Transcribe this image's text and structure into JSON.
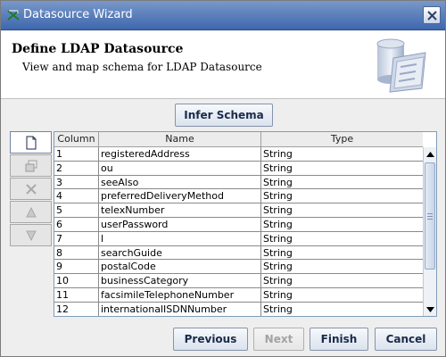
{
  "window": {
    "title": "Datasource Wizard"
  },
  "header": {
    "title": "Define LDAP Datasource",
    "subtitle": "View and map schema for LDAP Datasource"
  },
  "infer_button": "Infer Schema",
  "table": {
    "headers": [
      "Column",
      "Name",
      "Type"
    ],
    "rows": [
      [
        "1",
        "registeredAddress",
        "String"
      ],
      [
        "2",
        "ou",
        "String"
      ],
      [
        "3",
        "seeAlso",
        "String"
      ],
      [
        "4",
        "preferredDeliveryMethod",
        "String"
      ],
      [
        "5",
        "telexNumber",
        "String"
      ],
      [
        "6",
        "userPassword",
        "String"
      ],
      [
        "7",
        "l",
        "String"
      ],
      [
        "8",
        "searchGuide",
        "String"
      ],
      [
        "9",
        "postalCode",
        "String"
      ],
      [
        "10",
        "businessCategory",
        "String"
      ],
      [
        "11",
        "facsimileTelephoneNumber",
        "String"
      ],
      [
        "12",
        "internationalISDNNumber",
        "String"
      ]
    ]
  },
  "toolbar": {
    "icons": [
      "new-icon",
      "copy-icon",
      "delete-icon",
      "move-up-icon",
      "move-down-icon"
    ]
  },
  "footer": {
    "previous": "Previous",
    "next": "Next",
    "finish": "Finish",
    "cancel": "Cancel"
  },
  "colors": {
    "title_bar": "#5a7fbf",
    "accent": "#3e67ad",
    "button_text": "#1a2b4a"
  }
}
